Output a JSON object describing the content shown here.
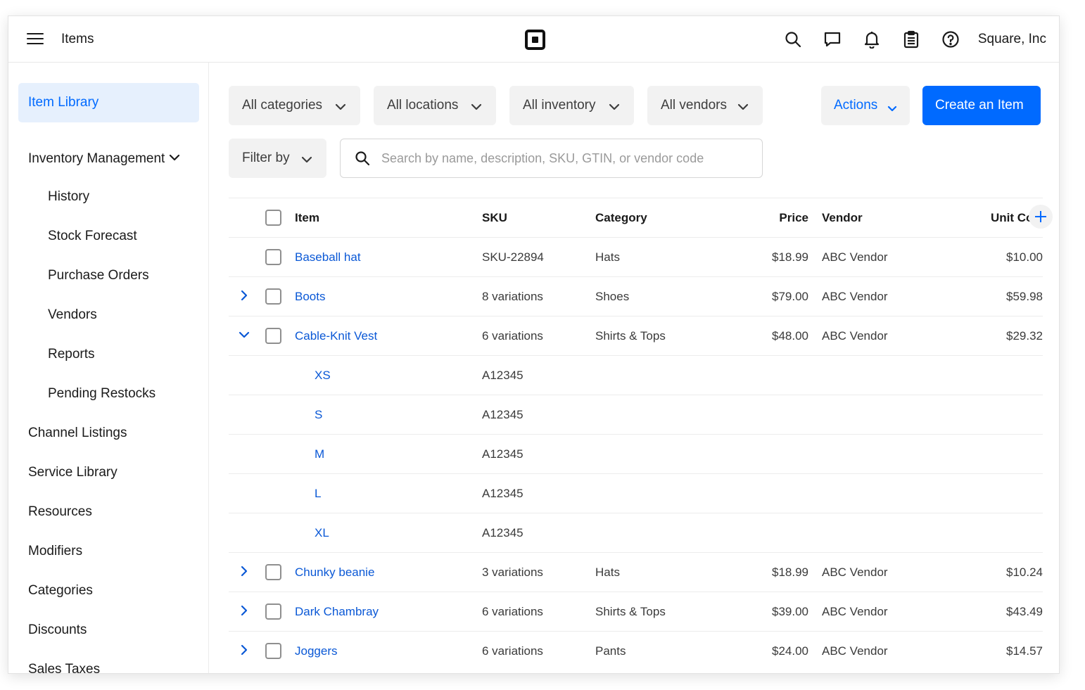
{
  "header": {
    "title": "Items",
    "company": "Square, Inc"
  },
  "sidebar": {
    "items": [
      {
        "label": "Item Library",
        "active": true
      },
      {
        "label": "Inventory Management",
        "expanded": true
      },
      {
        "label": "History"
      },
      {
        "label": "Stock Forecast"
      },
      {
        "label": "Purchase Orders"
      },
      {
        "label": "Vendors"
      },
      {
        "label": "Reports"
      },
      {
        "label": "Pending Restocks"
      },
      {
        "label": "Channel Listings"
      },
      {
        "label": "Service Library"
      },
      {
        "label": "Resources"
      },
      {
        "label": "Modifiers"
      },
      {
        "label": "Categories"
      },
      {
        "label": "Discounts"
      },
      {
        "label": "Sales Taxes"
      }
    ]
  },
  "filters": {
    "categories": "All categories",
    "locations": "All locations",
    "inventory": "All inventory",
    "vendors": "All vendors",
    "filter_by": "Filter by",
    "actions": "Actions",
    "create": "Create an Item",
    "search_placeholder": "Search by name, description, SKU, GTIN, or vendor code"
  },
  "table": {
    "headers": {
      "item": "Item",
      "sku": "SKU",
      "category": "Category",
      "price": "Price",
      "vendor": "Vendor",
      "unit_cost": "Unit Cost"
    },
    "rows": [
      {
        "item": "Baseball hat",
        "sku": "SKU-22894",
        "category": "Hats",
        "price": "$18.99",
        "vendor": "ABC Vendor",
        "unit_cost": "$10.00"
      },
      {
        "item": "Boots",
        "sku": "8 variations",
        "category": "Shoes",
        "price": "$79.00",
        "vendor": "ABC Vendor",
        "unit_cost": "$59.98"
      },
      {
        "item": "Cable-Knit Vest",
        "sku": "6 variations",
        "category": "Shirts & Tops",
        "price": "$48.00",
        "vendor": "ABC Vendor",
        "unit_cost": "$29.32"
      },
      {
        "item": "XS",
        "sku": "A12345"
      },
      {
        "item": "S",
        "sku": "A12345"
      },
      {
        "item": "M",
        "sku": "A12345"
      },
      {
        "item": "L",
        "sku": "A12345"
      },
      {
        "item": "XL",
        "sku": "A12345"
      },
      {
        "item": "Chunky beanie",
        "sku": "3 variations",
        "category": "Hats",
        "price": "$18.99",
        "vendor": "ABC Vendor",
        "unit_cost": "$10.24"
      },
      {
        "item": "Dark Chambray",
        "sku": "6 variations",
        "category": "Shirts & Tops",
        "price": "$39.00",
        "vendor": "ABC Vendor",
        "unit_cost": "$43.49"
      },
      {
        "item": "Joggers",
        "sku": "6 variations",
        "category": "Pants",
        "price": "$24.00",
        "vendor": "ABC Vendor",
        "unit_cost": "$14.57"
      }
    ]
  },
  "colors": {
    "accent": "#006aff",
    "link": "#0a58d6",
    "active_bg": "#e6f0fd"
  }
}
